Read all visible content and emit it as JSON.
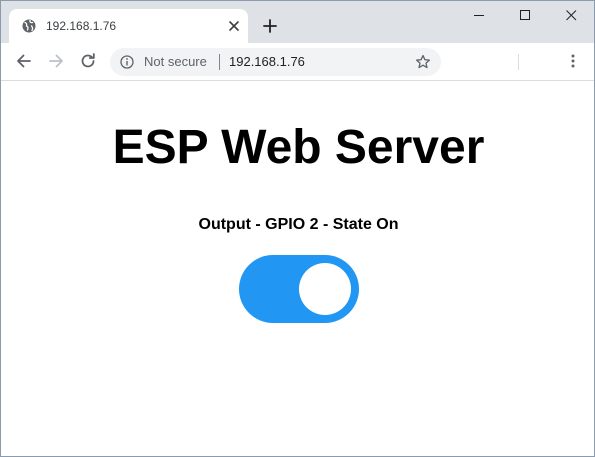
{
  "browser": {
    "tab": {
      "title": "192.168.1.76",
      "favicon": "globe-icon",
      "close": "close-icon"
    },
    "new_tab": "plus-icon",
    "window_controls": [
      "minimize-icon",
      "maximize-icon",
      "close-icon"
    ],
    "toolbar": {
      "back": "arrow-left-icon",
      "forward": "arrow-right-icon",
      "reload": "reload-icon",
      "security_label": "Not secure",
      "url": "192.168.1.76",
      "bookmark": "star-icon",
      "menu": "kebab-menu-icon"
    }
  },
  "page": {
    "title": "ESP Web Server",
    "output_label": "Output - GPIO 2 - State On",
    "toggle": {
      "state": "on",
      "color": "#2196f3"
    }
  }
}
